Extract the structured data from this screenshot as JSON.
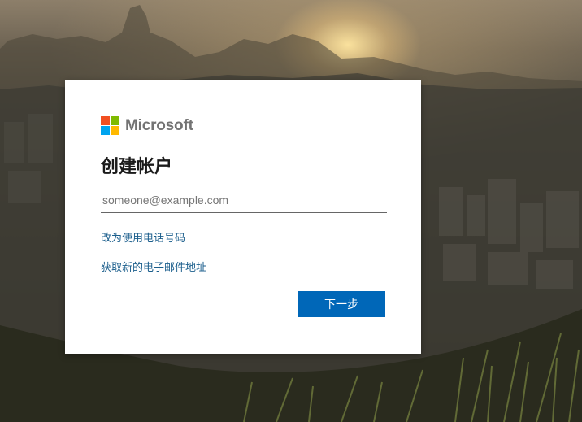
{
  "logo": {
    "text": "Microsoft",
    "colors": [
      "#f25022",
      "#7fba00",
      "#00a4ef",
      "#ffb900"
    ]
  },
  "dialog": {
    "title": "创建帐户",
    "email": {
      "placeholder": "someone@example.com",
      "value": ""
    },
    "use_phone_link": "改为使用电话号码",
    "new_email_link": "获取新的电子邮件地址",
    "next_button": "下一步"
  },
  "colors": {
    "accent": "#0067b8",
    "link": "#1b5e8c"
  }
}
